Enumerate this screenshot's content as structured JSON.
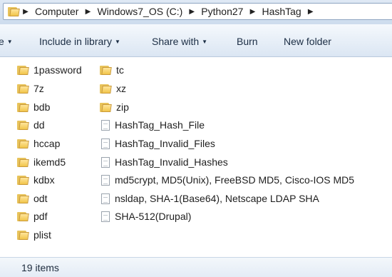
{
  "address": {
    "crumbs": [
      "Computer",
      "Windows7_OS (C:)",
      "Python27",
      "HashTag"
    ]
  },
  "toolbar": {
    "organize_partial": "e",
    "include_label": "Include in library",
    "share_label": "Share with",
    "burn_label": "Burn",
    "new_folder_label": "New folder"
  },
  "files": {
    "col1": [
      {
        "name": "1password",
        "icon": "folder-icon"
      },
      {
        "name": "7z",
        "icon": "folder-icon"
      },
      {
        "name": "bdb",
        "icon": "folder-icon"
      },
      {
        "name": "dd",
        "icon": "folder-icon"
      },
      {
        "name": "hccap",
        "icon": "folder-icon"
      },
      {
        "name": "ikemd5",
        "icon": "folder-icon"
      },
      {
        "name": "kdbx",
        "icon": "folder-icon"
      },
      {
        "name": "odt",
        "icon": "folder-icon"
      },
      {
        "name": "pdf",
        "icon": "folder-icon"
      },
      {
        "name": "plist",
        "icon": "folder-icon"
      }
    ],
    "col2": [
      {
        "name": "tc",
        "icon": "folder-icon"
      },
      {
        "name": "xz",
        "icon": "folder-icon"
      },
      {
        "name": "zip",
        "icon": "folder-icon"
      },
      {
        "name": "HashTag_Hash_File",
        "icon": "file-icon"
      },
      {
        "name": "HashTag_Invalid_Files",
        "icon": "file-icon"
      },
      {
        "name": "HashTag_Invalid_Hashes",
        "icon": "file-icon"
      },
      {
        "name": "md5crypt, MD5(Unix), FreeBSD MD5, Cisco-IOS MD5",
        "icon": "file-icon"
      },
      {
        "name": "nsldap, SHA-1(Base64), Netscape LDAP SHA",
        "icon": "file-icon"
      },
      {
        "name": "SHA-512(Drupal)",
        "icon": "file-icon"
      }
    ]
  },
  "status": {
    "item_count": "19 items"
  }
}
